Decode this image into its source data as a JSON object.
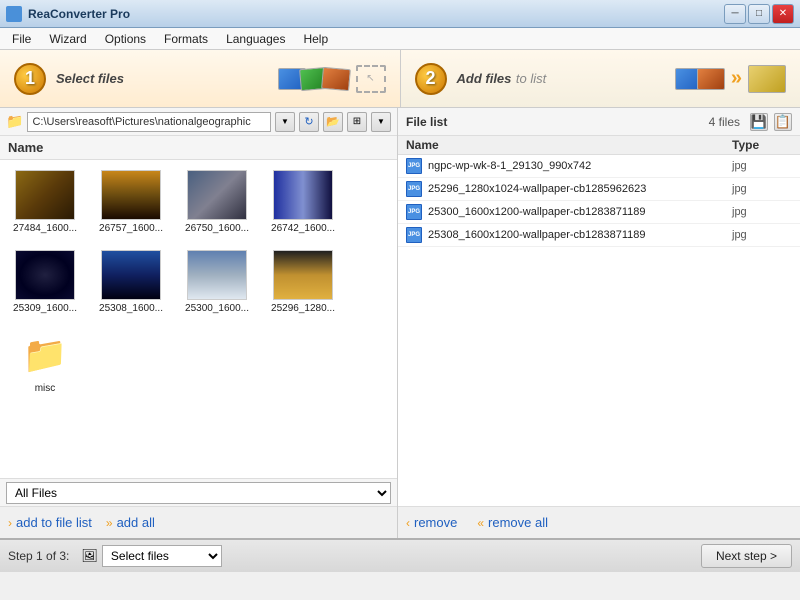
{
  "titlebar": {
    "title": "ReaConverter Pro",
    "min": "─",
    "max": "□",
    "close": "✕"
  },
  "menu": {
    "items": [
      "File",
      "Wizard",
      "Options",
      "Formats",
      "Languages",
      "Help"
    ]
  },
  "step1": {
    "number": "1",
    "label_bold": "Select files",
    "label_rest": ""
  },
  "step2": {
    "number": "2",
    "label_bold": "Add files",
    "label_rest": " to list"
  },
  "left": {
    "path": "C:\\Users\\reasoft\\Pictures\\nationalgeographic",
    "col_name": "Name",
    "files": [
      {
        "label": "27484_1600...",
        "thumb": "thumb-1"
      },
      {
        "label": "26757_1600...",
        "thumb": "thumb-2"
      },
      {
        "label": "26750_1600...",
        "thumb": "thumb-3"
      },
      {
        "label": "26742_1600...",
        "thumb": "thumb-4"
      },
      {
        "label": "25309_1600...",
        "thumb": "thumb-5"
      },
      {
        "label": "25308_1600...",
        "thumb": "thumb-6"
      },
      {
        "label": "25300_1600...",
        "thumb": "thumb-7"
      },
      {
        "label": "25296_1280...",
        "thumb": "thumb-8"
      }
    ],
    "folder": {
      "label": "misc"
    },
    "filter": "All Files",
    "add_btn": "add to file list",
    "add_all_btn": "add all"
  },
  "right": {
    "filelist_title": "File list",
    "file_count": "4 files",
    "col_name": "Name",
    "col_type": "Type",
    "files": [
      {
        "name": "ngpc-wp-wk-8-1_29130_990x742",
        "type": "jpg"
      },
      {
        "name": "25296_1280x1024-wallpaper-cb1285962623",
        "type": "jpg"
      },
      {
        "name": "25300_1600x1200-wallpaper-cb1283871189",
        "type": "jpg"
      },
      {
        "name": "25308_1600x1200-wallpaper-cb1283871189",
        "type": "jpg"
      }
    ],
    "remove_btn": "remove",
    "remove_all_btn": "remove all"
  },
  "statusbar": {
    "step_label": "Step 1 of 3:",
    "step_value": "Select files",
    "next_btn": "Next step >"
  }
}
